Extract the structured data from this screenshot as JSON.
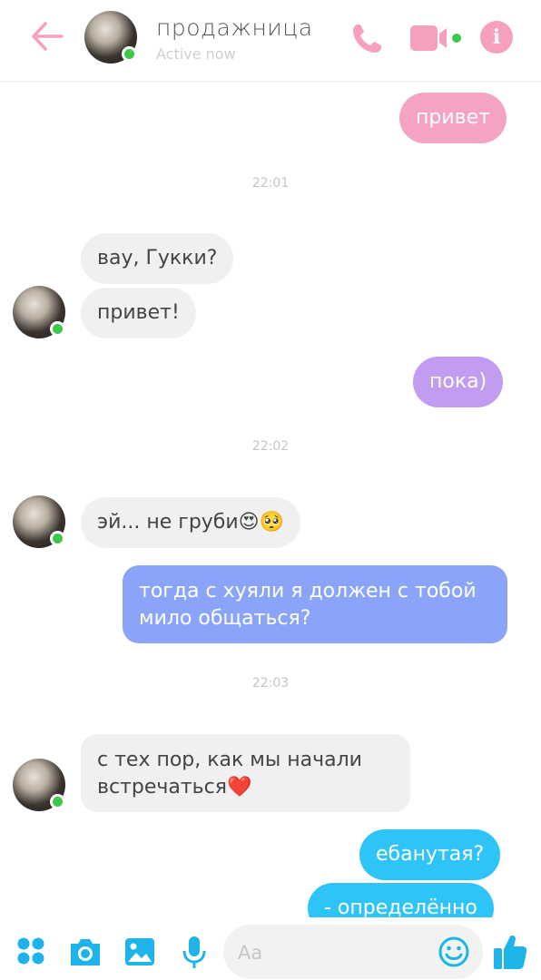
{
  "colors": {
    "accent_pink": "#f7a0bb",
    "online_green": "#3cc84a",
    "incoming_bg": "#f1f0f0",
    "composer_blue": "#1eb4ea"
  },
  "header": {
    "back_icon": "arrow-left-icon",
    "contact_name": "продажница",
    "status": "Active now",
    "call_icon": "phone-icon",
    "video_icon": "video-camera-icon",
    "info_label": "i"
  },
  "messages": [
    {
      "direction": "out",
      "text": "привет",
      "color": "#f5a3c3"
    },
    {
      "timestamp": "22:01"
    },
    {
      "direction": "in",
      "text": "вау, Гукки?"
    },
    {
      "direction": "in",
      "text": "привет!"
    },
    {
      "direction": "out",
      "text": "пока)",
      "color": "#c19cf0"
    },
    {
      "timestamp": "22:02"
    },
    {
      "direction": "in",
      "text": "эй... не груби😍🥺"
    },
    {
      "direction": "out",
      "lines": [
        "тогда с хуяли я должен с тобой",
        "мило общаться?"
      ],
      "color": "#8aa4f9"
    },
    {
      "timestamp": "22:03"
    },
    {
      "direction": "in",
      "lines": [
        "с тех пор, как мы начали",
        "встречаться❤️"
      ]
    },
    {
      "direction": "out",
      "text": "ебанутая?",
      "color": "#2ec4f7"
    },
    {
      "direction": "out",
      "text": "- определённо",
      "color": "#2ec4f7"
    }
  ],
  "composer": {
    "menu_icon": "grid-dots-icon",
    "camera_icon": "camera-icon",
    "gallery_icon": "image-icon",
    "mic_icon": "microphone-icon",
    "placeholder": "Aa",
    "emoji_icon": "smiley-icon",
    "like_icon": "thumbs-up-icon"
  }
}
